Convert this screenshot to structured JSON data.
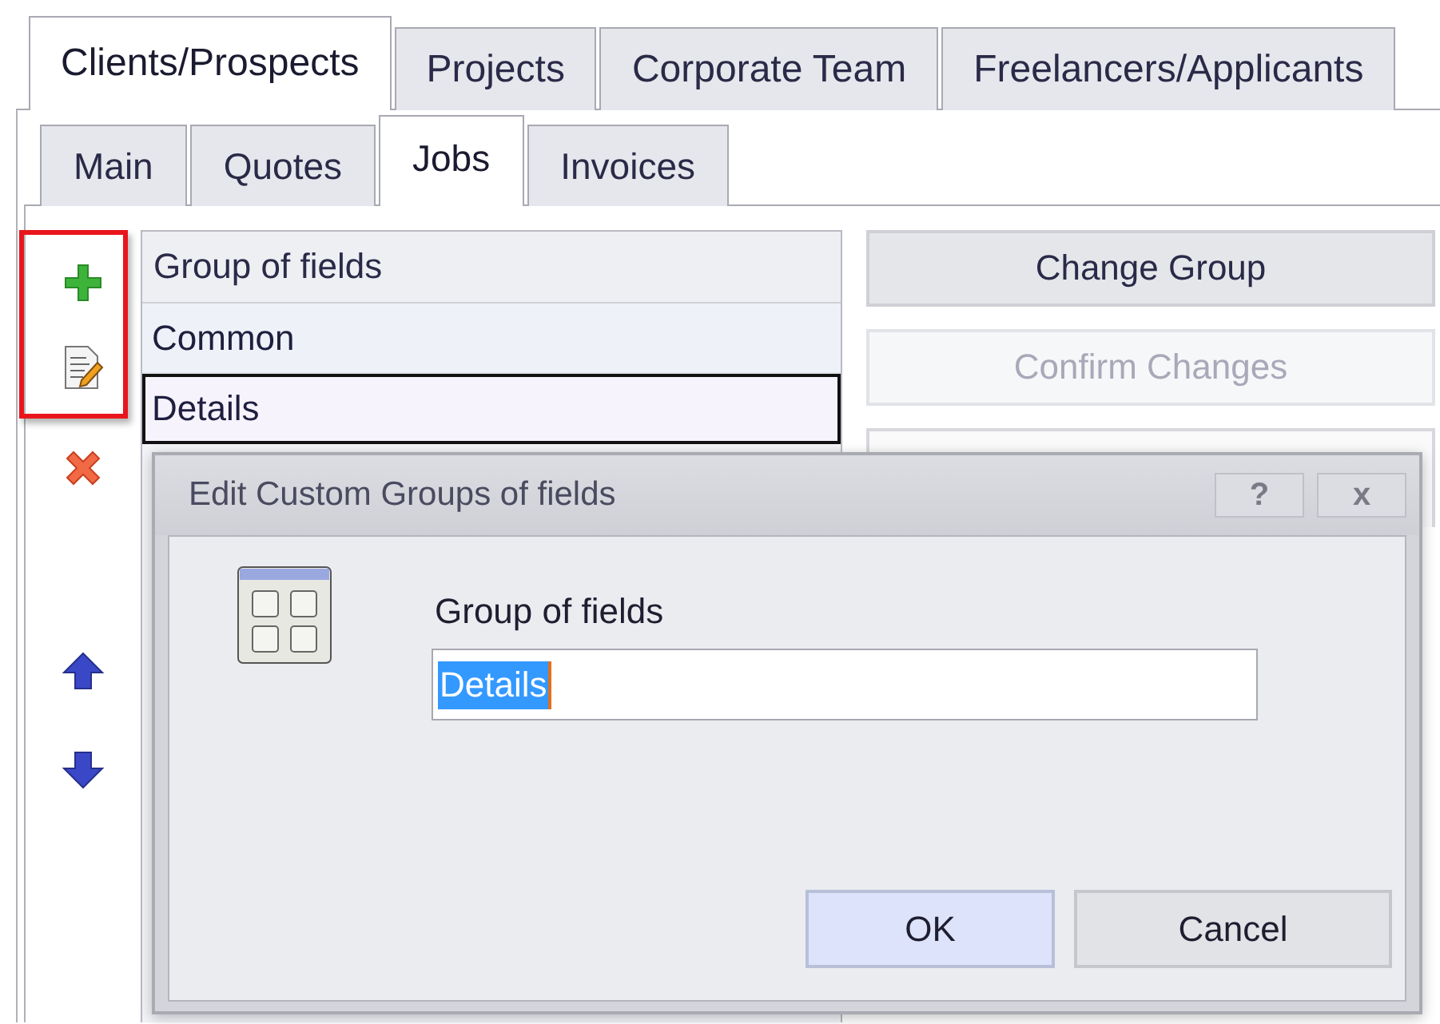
{
  "main_tabs": [
    {
      "label": "Clients/Prospects",
      "selected": true
    },
    {
      "label": "Projects",
      "selected": false
    },
    {
      "label": "Corporate Team",
      "selected": false
    },
    {
      "label": "Freelancers/Applicants",
      "selected": false
    }
  ],
  "sub_tabs": [
    {
      "label": "Main",
      "selected": false
    },
    {
      "label": "Quotes",
      "selected": false
    },
    {
      "label": "Jobs",
      "selected": true
    },
    {
      "label": "Invoices",
      "selected": false
    }
  ],
  "toolbar": [
    {
      "kind": "add",
      "highlighted": true
    },
    {
      "kind": "edit",
      "highlighted": true
    },
    {
      "kind": "delete",
      "highlighted": false
    },
    {
      "kind": "up",
      "highlighted": false
    },
    {
      "kind": "down",
      "highlighted": false
    }
  ],
  "grid": {
    "header": "Group of fields",
    "rows": [
      {
        "text": "Common",
        "selected": false
      },
      {
        "text": "Details",
        "selected": true
      }
    ]
  },
  "actions": [
    {
      "label": "Change Group",
      "disabled": false
    },
    {
      "label": "Confirm Changes",
      "disabled": true
    }
  ],
  "dialog": {
    "title": "Edit Custom Groups of fields",
    "help": "?",
    "close": "x",
    "field_label": "Group of fields",
    "value": "Details",
    "value_selected": true,
    "buttons": [
      {
        "label": "OK",
        "default": true
      },
      {
        "label": "Cancel",
        "default": false
      }
    ]
  }
}
